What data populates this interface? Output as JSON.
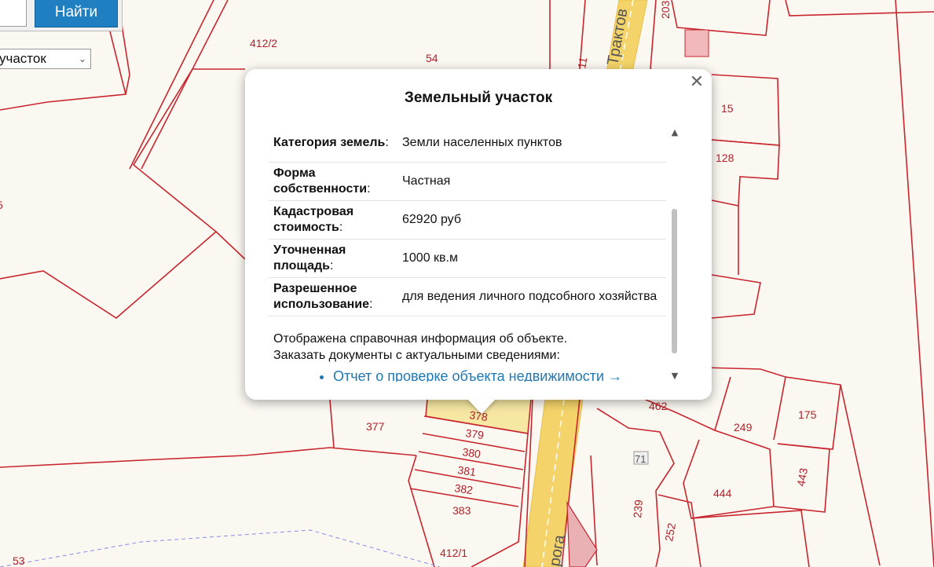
{
  "search": {
    "button_label": "Найти",
    "select_value": "участок"
  },
  "popup": {
    "title": "Земельный участок",
    "close_glyph": "✕",
    "rows": [
      {
        "key": "Категория земель",
        "value": "Земли населенных пунктов"
      },
      {
        "key": "Форма собственности",
        "value": "Частная"
      },
      {
        "key": "Кадастровая стоимость",
        "value": "62920 руб"
      },
      {
        "key": "Уточненная площадь",
        "value": "1000 кв.м"
      },
      {
        "key": "Разрешенное использование",
        "value": "для ведения личного подсобного хозяйства"
      }
    ],
    "note_line1": "Отображена справочная информация об объекте.",
    "note_line2": "Заказать документы с актуальными сведениями:",
    "report_link": "Отчет о проверке объекта недвижимости →"
  },
  "map": {
    "labels": {
      "p412_2": "412/2",
      "p54": "54",
      "p15": "15",
      "p128": "128",
      "p377": "377",
      "p378": "378",
      "p379": "379",
      "p380": "380",
      "p381": "381",
      "p382": "382",
      "p383": "383",
      "p412_1": "412/1",
      "p53": "53",
      "p462": "462",
      "p249": "249",
      "p175": "175",
      "p443": "443",
      "p444": "444",
      "p239": "239",
      "p252": "252",
      "p71": "71",
      "p203": "203",
      "p11": "11",
      "p5": "5"
    },
    "road_top": "Трактов",
    "road_bottom": "рога"
  },
  "colors": {
    "parcel_stroke": "#c8262f",
    "highlight": "#f6e7a2",
    "road": "#f4d46a",
    "button": "#1f7fc1",
    "link": "#1f78b4"
  }
}
